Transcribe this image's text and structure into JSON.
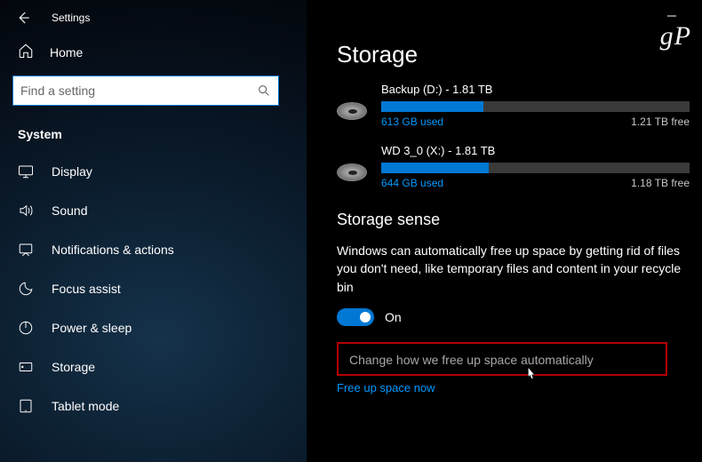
{
  "window": {
    "title": "Settings",
    "minimize_tooltip": "Minimize"
  },
  "logo": "gP",
  "sidebar": {
    "home_label": "Home",
    "search_placeholder": "Find a setting",
    "category": "System",
    "items": [
      {
        "label": "Display",
        "icon": "display-icon"
      },
      {
        "label": "Sound",
        "icon": "sound-icon"
      },
      {
        "label": "Notifications & actions",
        "icon": "notifications-icon"
      },
      {
        "label": "Focus assist",
        "icon": "focus-assist-icon"
      },
      {
        "label": "Power & sleep",
        "icon": "power-icon"
      },
      {
        "label": "Storage",
        "icon": "storage-icon"
      },
      {
        "label": "Tablet mode",
        "icon": "tablet-icon"
      }
    ]
  },
  "page": {
    "title": "Storage",
    "drives": [
      {
        "name": "Backup (D:) - 1.81 TB",
        "used_label": "613 GB used",
        "free_label": "1.21 TB free",
        "fill_pct": 33
      },
      {
        "name": "WD 3_0 (X:) - 1.81 TB",
        "used_label": "644 GB used",
        "free_label": "1.18 TB free",
        "fill_pct": 35
      }
    ],
    "storage_sense": {
      "title": "Storage sense",
      "description": "Windows can automatically free up space by getting rid of files you don't need, like temporary files and content in your recycle bin",
      "toggle_state": "On",
      "toggle_on": true,
      "change_link": "Change how we free up space automatically",
      "free_now_link": "Free up space now"
    }
  }
}
